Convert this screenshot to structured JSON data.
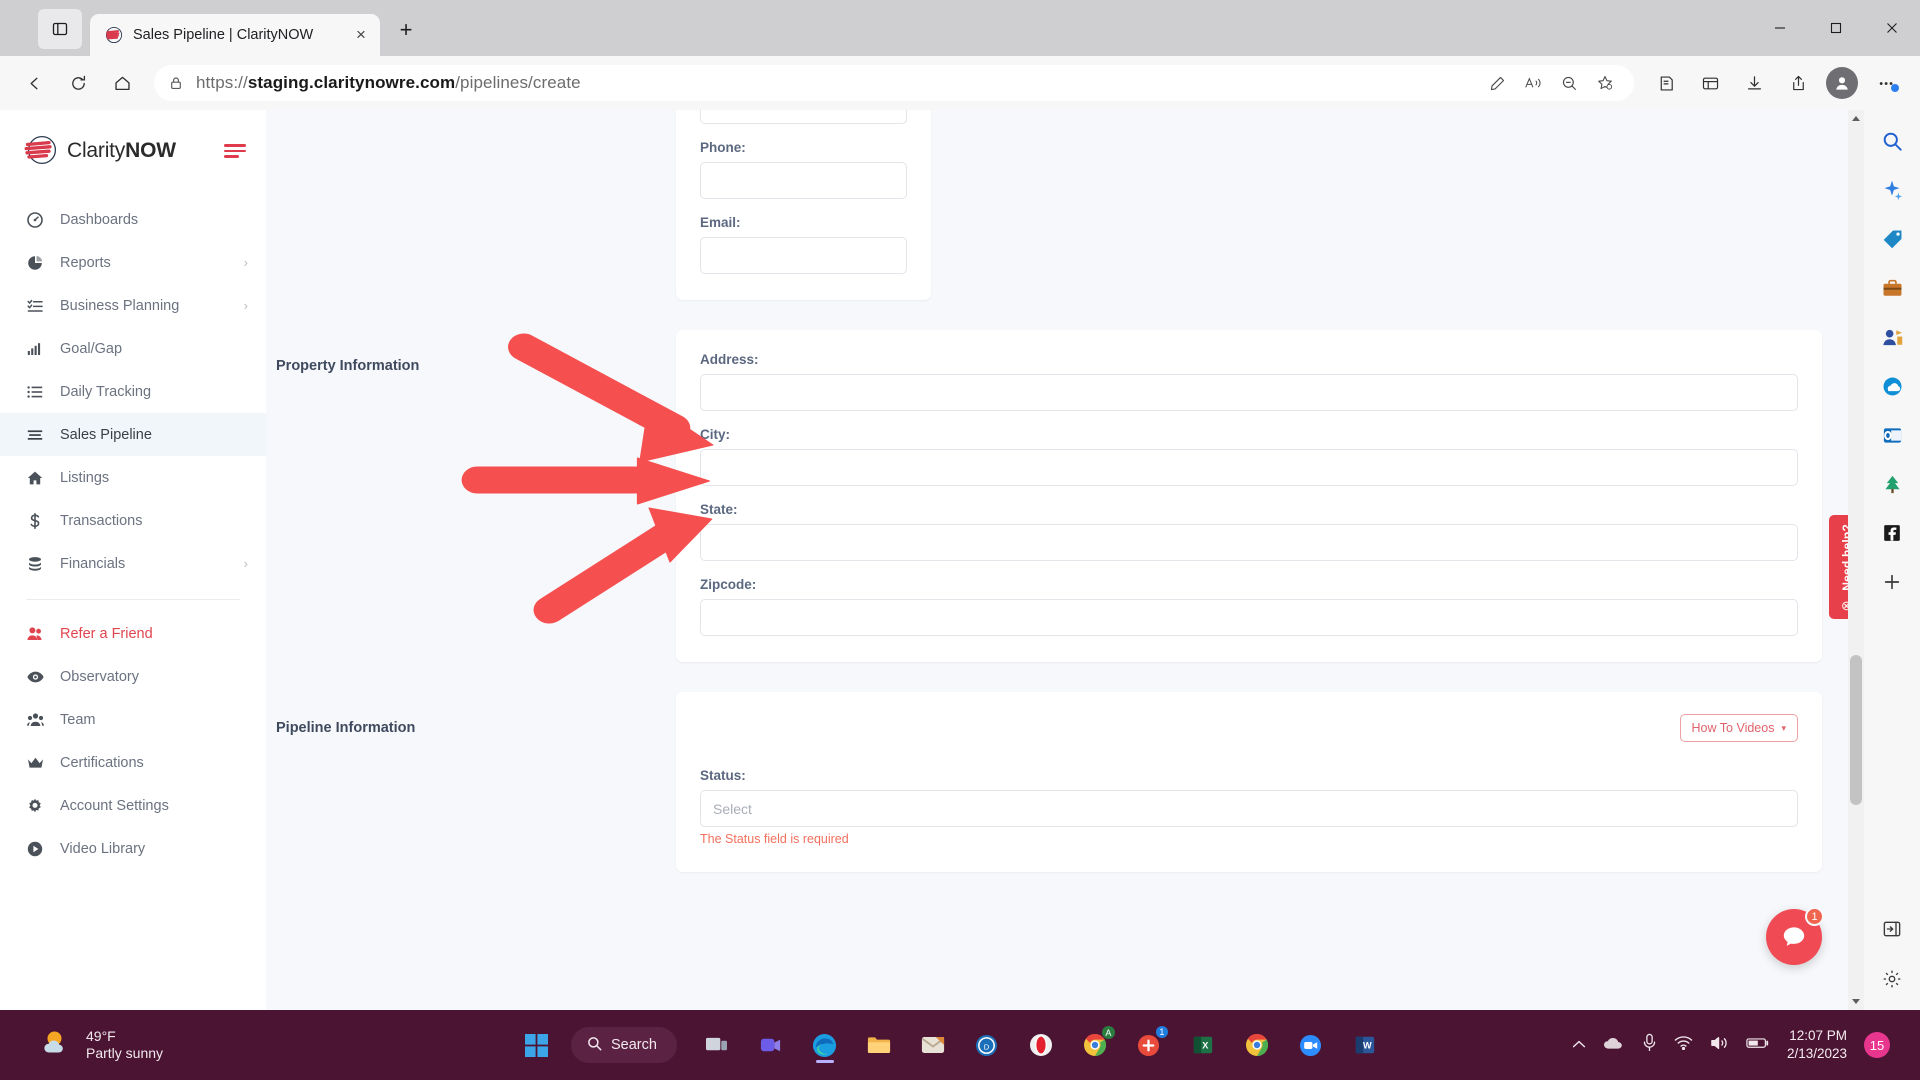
{
  "browser": {
    "tab": {
      "title": "Sales Pipeline | ClarityNOW",
      "close_label": "×",
      "favicon": "claritynow-logo-icon"
    },
    "newtab_label": "+",
    "url": {
      "scheme": "https://",
      "host": "staging.claritynowre.com",
      "path": "/pipelines/create"
    },
    "window_controls": {
      "minimize": "─",
      "maximize": "□",
      "close": "✕"
    }
  },
  "sidebar": {
    "brand": {
      "name_light": "Clarity",
      "name_bold": "NOW"
    },
    "items": [
      {
        "label": "Dashboards",
        "icon": "speedometer-icon",
        "chevron": "",
        "state": ""
      },
      {
        "label": "Reports",
        "icon": "pie-chart-icon",
        "chevron": "›",
        "state": ""
      },
      {
        "label": "Business Planning",
        "icon": "checklist-icon",
        "chevron": "›",
        "state": ""
      },
      {
        "label": "Goal/Gap",
        "icon": "bar-chart-icon",
        "chevron": "",
        "state": ""
      },
      {
        "label": "Daily Tracking",
        "icon": "list-icon",
        "chevron": "",
        "state": ""
      },
      {
        "label": "Sales Pipeline",
        "icon": "hamburger-lines-icon",
        "chevron": "",
        "state": "active"
      },
      {
        "label": "Listings",
        "icon": "home-icon",
        "chevron": "",
        "state": ""
      },
      {
        "label": "Transactions",
        "icon": "dollar-icon",
        "chevron": "",
        "state": ""
      },
      {
        "label": "Financials",
        "icon": "coins-icon",
        "chevron": "›",
        "state": ""
      }
    ],
    "items2": [
      {
        "label": "Refer a Friend",
        "icon": "two-users-icon",
        "chevron": "",
        "state": "accent"
      },
      {
        "label": "Observatory",
        "icon": "eye-icon",
        "chevron": "",
        "state": ""
      },
      {
        "label": "Team",
        "icon": "group-users-icon",
        "chevron": "",
        "state": ""
      },
      {
        "label": "Certifications",
        "icon": "crown-icon",
        "chevron": "",
        "state": ""
      },
      {
        "label": "Account Settings",
        "icon": "gear-icon",
        "chevron": "",
        "state": ""
      },
      {
        "label": "Video Library",
        "icon": "play-circle-icon",
        "chevron": "",
        "state": ""
      }
    ]
  },
  "form": {
    "contact_section": {
      "fields": [
        {
          "label": "Phone:",
          "value": "",
          "placeholder": ""
        },
        {
          "label": "Email:",
          "value": "",
          "placeholder": ""
        }
      ]
    },
    "property_section": {
      "title": "Property Information",
      "fields": [
        {
          "label": "Address:",
          "value": "",
          "placeholder": ""
        },
        {
          "label": "City:",
          "value": "",
          "placeholder": ""
        },
        {
          "label": "State:",
          "value": "",
          "placeholder": ""
        },
        {
          "label": "Zipcode:",
          "value": "",
          "placeholder": ""
        }
      ]
    },
    "pipeline_section": {
      "title": "Pipeline Information",
      "howto_label": "How To Videos",
      "howto_caret": "▾",
      "status": {
        "label": "Status:",
        "value": "",
        "placeholder": "Select",
        "error": "The Status field is required"
      }
    }
  },
  "widgets": {
    "need_help": {
      "text": "Need help?",
      "close": "⊗"
    },
    "chat": {
      "badge": "1"
    }
  },
  "taskbar": {
    "weather": {
      "temp": "49°F",
      "condition": "Partly sunny",
      "icon": "partly-sunny-icon"
    },
    "search": {
      "label": "Search",
      "icon": "search-icon"
    },
    "apps": [
      {
        "name": "start-icon"
      },
      {
        "name": "task-view-icon"
      },
      {
        "name": "teams-icon"
      },
      {
        "name": "edge-icon"
      },
      {
        "name": "file-explorer-icon"
      },
      {
        "name": "mail-icon"
      },
      {
        "name": "dell-icon"
      },
      {
        "name": "opera-icon"
      },
      {
        "name": "chrome-icon"
      },
      {
        "name": "slack-icon"
      },
      {
        "name": "excel-icon"
      },
      {
        "name": "chrome-beta-icon"
      },
      {
        "name": "zoom-icon"
      },
      {
        "name": "word-icon"
      }
    ],
    "tray": {
      "chevron": "^",
      "cloud": "cloud-icon",
      "mic": "microphone-icon",
      "wifi": "wifi-icon",
      "volume": "volume-icon",
      "battery": "battery-icon"
    },
    "clock": {
      "time": "12:07 PM",
      "date": "2/13/2023"
    },
    "notification_count": "15"
  },
  "colors": {
    "brand_red": "#e0454f",
    "taskbar": "#4b1433",
    "active_nav_bg": "#f1f6fb",
    "label_blue": "#5b6880",
    "error_red": "#f2705d",
    "annotation_red": "#f5504f"
  }
}
